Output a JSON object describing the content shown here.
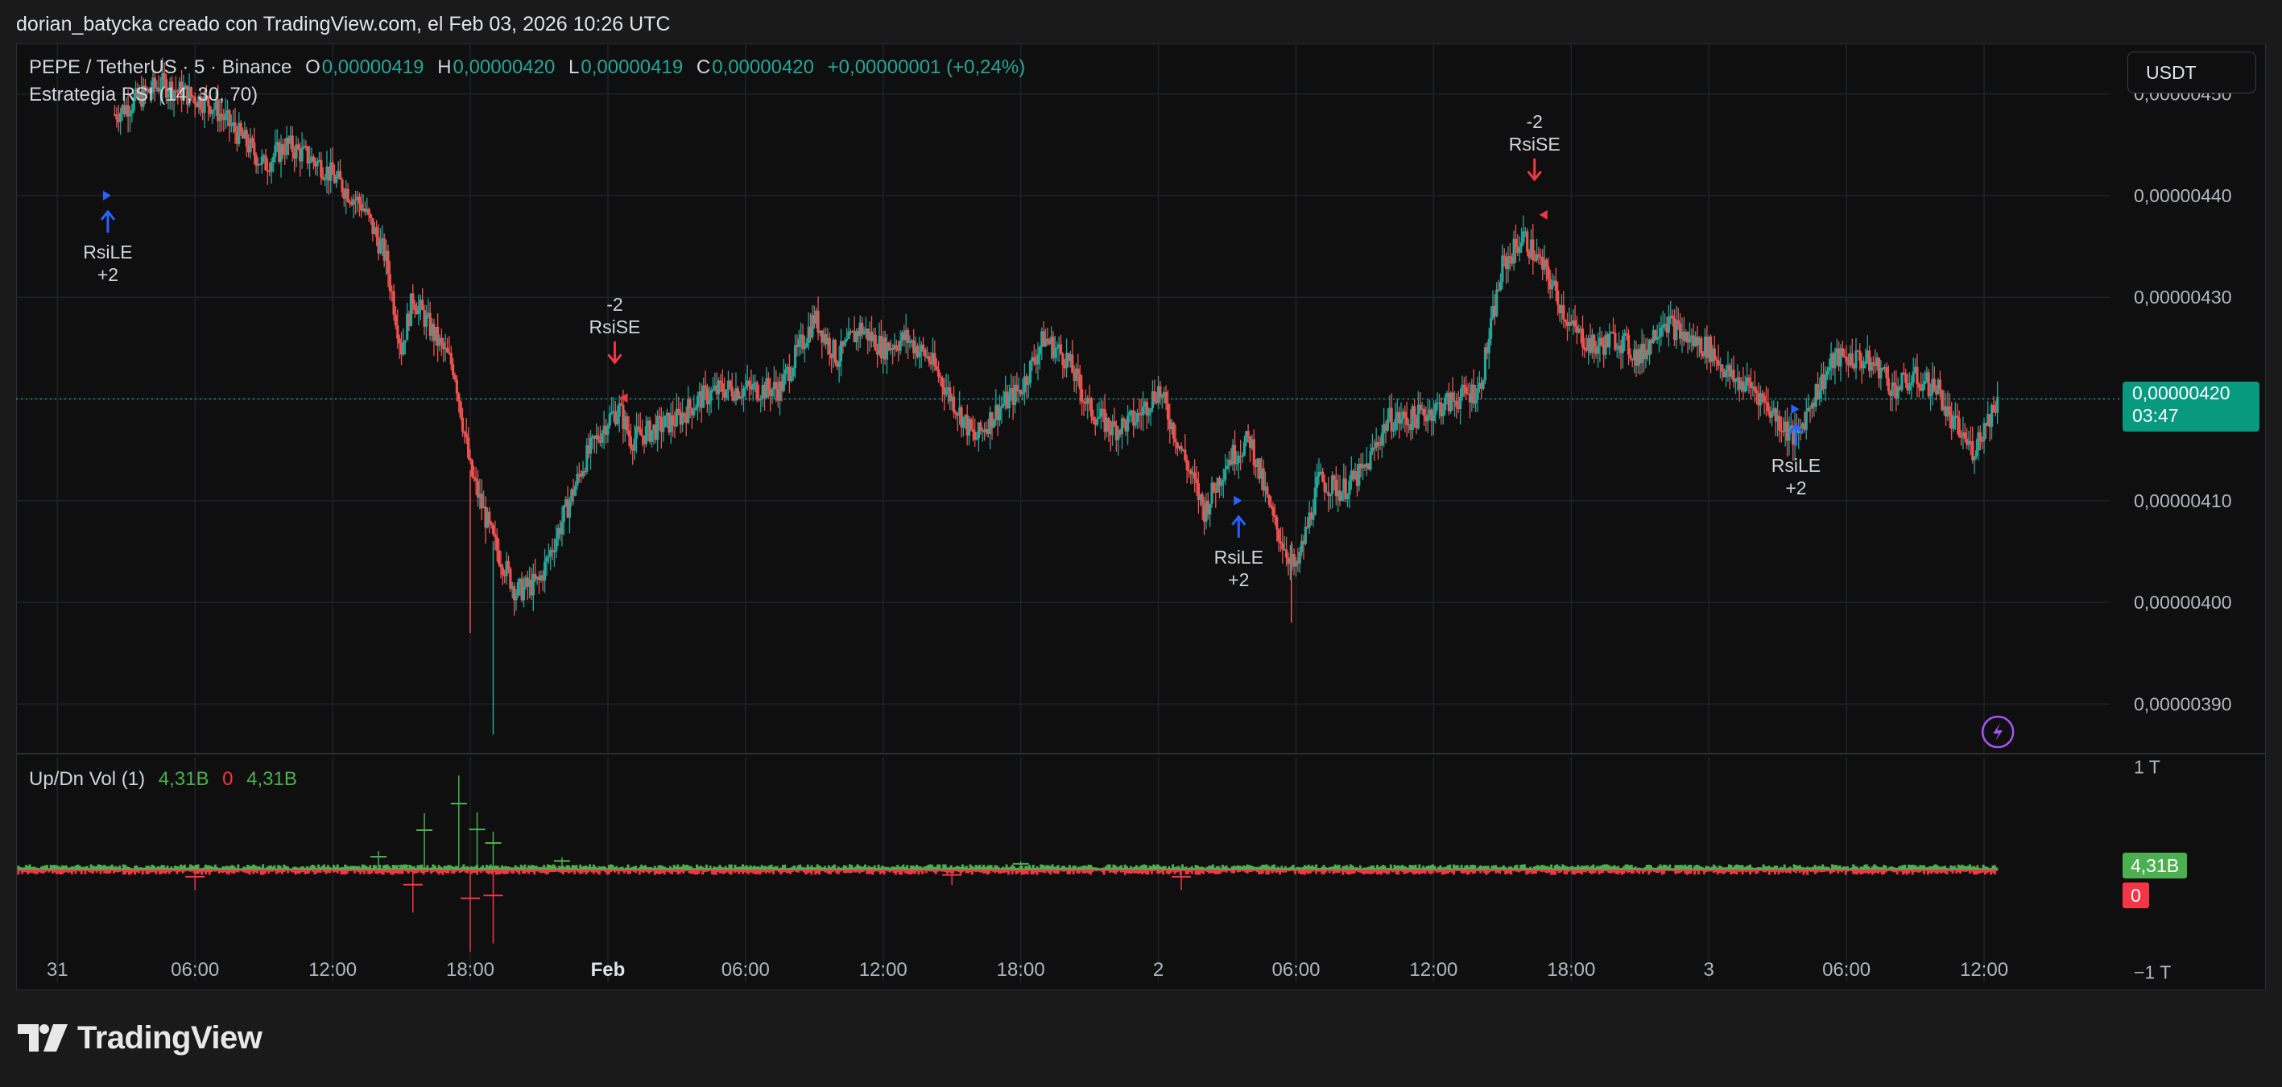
{
  "caption": "dorian_batycka creado con TradingView.com, el Feb 03, 2026 10:26 UTC",
  "legend": {
    "symbol": "PEPE / TetherUS · 5 · Binance",
    "o_label": "O",
    "o_val": "0,00000419",
    "h_label": "H",
    "h_val": "0,00000420",
    "l_label": "L",
    "l_val": "0,00000419",
    "c_label": "C",
    "c_val": "0,00000420",
    "change": "+0,00000001 (+0,24%)",
    "strategy": "Estrategia RSI (14, 30, 70)"
  },
  "currency_button": "USDT",
  "price_tag": {
    "price": "0,00000420",
    "countdown": "03:47"
  },
  "volume_legend": {
    "name": "Up/Dn Vol (1)",
    "up": "4,31B",
    "down": "0",
    "delta": "4,31B"
  },
  "volume_tags": {
    "up": "4,31B",
    "down": "0"
  },
  "brand": "TradingView",
  "colors": {
    "up": "#26a69a",
    "down": "#ef5350",
    "vol_up": "#4caf50",
    "vol_down": "#f23645",
    "long_signal": "#2962ff",
    "short_signal": "#f23645",
    "current_price_tag": "#089981"
  },
  "chart_data": [
    {
      "type": "candlestick",
      "title": "PEPE / TetherUS · 5 · Binance",
      "ylim": [
        3.852e-06,
        4.548e-06
      ],
      "y_ticks": [
        {
          "value": 4.5e-06,
          "label": "0,00000450"
        },
        {
          "value": 4.4e-06,
          "label": "0,00000440"
        },
        {
          "value": 4.3e-06,
          "label": "0,00000430"
        },
        {
          "value": 4.2e-06,
          "label": "0,00000420"
        },
        {
          "value": 4.1e-06,
          "label": "0,00000410"
        },
        {
          "value": 4e-06,
          "label": "0,00000400"
        },
        {
          "value": 3.9e-06,
          "label": "0,00000390"
        }
      ],
      "x_ticks": [
        {
          "t": 0,
          "label": "31"
        },
        {
          "t": 6,
          "label": "06:00"
        },
        {
          "t": 12,
          "label": "12:00"
        },
        {
          "t": 18,
          "label": "18:00"
        },
        {
          "t": 24,
          "label": "Feb"
        },
        {
          "t": 30,
          "label": "06:00"
        },
        {
          "t": 36,
          "label": "12:00"
        },
        {
          "t": 42,
          "label": "18:00"
        },
        {
          "t": 48,
          "label": "2"
        },
        {
          "t": 54,
          "label": "06:00"
        },
        {
          "t": 60,
          "label": "12:00"
        },
        {
          "t": 66,
          "label": "18:00"
        },
        {
          "t": 72,
          "label": "3"
        },
        {
          "t": 78,
          "label": "06:00"
        },
        {
          "t": 84,
          "label": "12:00"
        }
      ],
      "xlim": [
        -1.8,
        89.3
      ],
      "current_price": 4.2e-06,
      "price_path": [
        [
          2.5,
          4.48e-06
        ],
        [
          4.5,
          4.51e-06
        ],
        [
          6.7,
          4.49e-06
        ],
        [
          7.5,
          4.47e-06
        ],
        [
          8.3,
          4.45e-06
        ],
        [
          9.0,
          4.43e-06
        ],
        [
          10.0,
          4.45e-06
        ],
        [
          11.5,
          4.43e-06
        ],
        [
          13.3,
          4.39e-06
        ],
        [
          14.3,
          4.34e-06
        ],
        [
          15.0,
          4.25e-06
        ],
        [
          15.5,
          4.3e-06
        ],
        [
          16.5,
          4.26e-06
        ],
        [
          17.3,
          4.23e-06
        ],
        [
          18.0,
          4.13e-06
        ],
        [
          19.0,
          4.06e-06
        ],
        [
          20.0,
          4.01e-06
        ],
        [
          21.0,
          4.02e-06
        ],
        [
          22.0,
          4.08e-06
        ],
        [
          23.0,
          4.14e-06
        ],
        [
          24.0,
          4.18e-06
        ],
        [
          24.5,
          4.19e-06
        ],
        [
          25.0,
          4.16e-06
        ],
        [
          26.0,
          4.17e-06
        ],
        [
          27.0,
          4.18e-06
        ],
        [
          28.0,
          4.2e-06
        ],
        [
          29.0,
          4.21e-06
        ],
        [
          30.0,
          4.21e-06
        ],
        [
          31.5,
          4.21e-06
        ],
        [
          33.0,
          4.28e-06
        ],
        [
          34.0,
          4.24e-06
        ],
        [
          35.0,
          4.27e-06
        ],
        [
          36.0,
          4.25e-06
        ],
        [
          37.0,
          4.26e-06
        ],
        [
          38.0,
          4.24e-06
        ],
        [
          39.0,
          4.2e-06
        ],
        [
          40.0,
          4.16e-06
        ],
        [
          41.0,
          4.19e-06
        ],
        [
          42.0,
          4.21e-06
        ],
        [
          43.0,
          4.26e-06
        ],
        [
          44.0,
          4.24e-06
        ],
        [
          45.0,
          4.19e-06
        ],
        [
          46.0,
          4.17e-06
        ],
        [
          47.0,
          4.18e-06
        ],
        [
          48.0,
          4.21e-06
        ],
        [
          49.0,
          4.15e-06
        ],
        [
          50.0,
          4.09e-06
        ],
        [
          51.0,
          4.14e-06
        ],
        [
          52.0,
          4.16e-06
        ],
        [
          53.0,
          4.08e-06
        ],
        [
          54.0,
          4.03e-06
        ],
        [
          55.0,
          4.12e-06
        ],
        [
          56.0,
          4.11e-06
        ],
        [
          57.0,
          4.13e-06
        ],
        [
          58.0,
          4.18e-06
        ],
        [
          59.0,
          4.18e-06
        ],
        [
          60.0,
          4.19e-06
        ],
        [
          61.0,
          4.2e-06
        ],
        [
          62.0,
          4.21e-06
        ],
        [
          63.0,
          4.33e-06
        ],
        [
          63.9,
          4.36e-06
        ],
        [
          65.0,
          4.32e-06
        ],
        [
          66.0,
          4.27e-06
        ],
        [
          67.0,
          4.25e-06
        ],
        [
          68.0,
          4.26e-06
        ],
        [
          69.0,
          4.24e-06
        ],
        [
          70.0,
          4.28e-06
        ],
        [
          71.0,
          4.26e-06
        ],
        [
          72.0,
          4.25e-06
        ],
        [
          73.0,
          4.22e-06
        ],
        [
          74.0,
          4.21e-06
        ],
        [
          75.0,
          4.18e-06
        ],
        [
          75.8,
          4.16e-06
        ],
        [
          76.5,
          4.2e-06
        ],
        [
          77.5,
          4.24e-06
        ],
        [
          78.5,
          4.24e-06
        ],
        [
          79.5,
          4.23e-06
        ],
        [
          80.0,
          4.21e-06
        ],
        [
          81.0,
          4.22e-06
        ],
        [
          82.0,
          4.21e-06
        ],
        [
          82.5,
          4.18e-06
        ],
        [
          83.5,
          4.15e-06
        ],
        [
          84.6,
          4.2e-06
        ]
      ],
      "signals": [
        {
          "t": 2.2,
          "kind": "long",
          "lines": [
            "RsiLE",
            "+2"
          ]
        },
        {
          "t": 24.3,
          "kind": "short",
          "lines": [
            "-2",
            "RsiSE"
          ]
        },
        {
          "t": 51.5,
          "kind": "long",
          "lines": [
            "RsiLE",
            "+2"
          ]
        },
        {
          "t": 64.4,
          "kind": "short",
          "lines": [
            "-2",
            "RsiSE"
          ]
        },
        {
          "t": 75.8,
          "kind": "long",
          "lines": [
            "RsiLE",
            "+2"
          ]
        }
      ],
      "signal_prices": [
        4.4e-06,
        4.22e-06,
        4.1e-06,
        4.4e-06,
        4.19e-06
      ]
    },
    {
      "type": "bar",
      "title": "Up/Dn Vol (1)",
      "ylim": [
        -1.1,
        1.1
      ],
      "y_ticks": [
        {
          "value": 1,
          "label": "1 T"
        },
        {
          "value": -1,
          "label": "−1 T"
        }
      ],
      "series": [
        {
          "name": "Up",
          "last": "4,31B"
        },
        {
          "name": "Down",
          "last": "0"
        }
      ],
      "spikes_up": [
        {
          "t": 14.0,
          "value": 0.18
        },
        {
          "t": 15.0,
          "value": 0.05
        },
        {
          "t": 16.0,
          "value": 0.55
        },
        {
          "t": 17.5,
          "value": 0.92
        },
        {
          "t": 18.3,
          "value": 0.56
        },
        {
          "t": 19.0,
          "value": 0.37
        },
        {
          "t": 22.0,
          "value": 0.12
        },
        {
          "t": 42.0,
          "value": 0.08
        }
      ],
      "spikes_down": [
        {
          "t": 6.0,
          "value": -0.2
        },
        {
          "t": 15.5,
          "value": -0.42
        },
        {
          "t": 18.0,
          "value": -0.8
        },
        {
          "t": 19.0,
          "value": -0.72
        },
        {
          "t": 39.0,
          "value": -0.15
        },
        {
          "t": 49.0,
          "value": -0.2
        }
      ]
    }
  ]
}
